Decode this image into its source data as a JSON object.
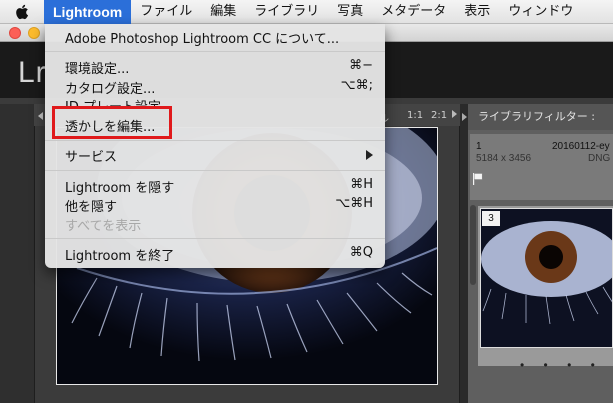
{
  "menubar": {
    "apple": "apple-icon",
    "items": [
      "Lightroom",
      "ファイル",
      "編集",
      "ライブラリ",
      "写真",
      "メタデータ",
      "表示",
      "ウィンドウ"
    ],
    "active_index": 0
  },
  "app": {
    "logo_text": "Lr"
  },
  "toolbar": {
    "zoom_fit": "ル",
    "zoom_1": "1:1",
    "zoom_2": "2:1"
  },
  "dropdown": {
    "items": [
      {
        "label": "Adobe Photoshop Lightroom CC について...",
        "shortcut": ""
      },
      {
        "label": "環境設定...",
        "shortcut": "⌘−"
      },
      {
        "label": "カタログ設定...",
        "shortcut": "⌥⌘;"
      },
      {
        "label": "ID プレート設定...",
        "shortcut": ""
      },
      {
        "label": "透かしを編集...",
        "shortcut": ""
      },
      {
        "label": "サービス",
        "shortcut": ""
      },
      {
        "label": "Lightroom を隠す",
        "shortcut": "⌘H"
      },
      {
        "label": "他を隠す",
        "shortcut": "⌥⌘H"
      },
      {
        "label": "すべてを表示",
        "shortcut": "",
        "disabled": true
      },
      {
        "label": "Lightroom を終了",
        "shortcut": "⌘Q"
      }
    ],
    "highlighted_item": "透かしを編集...",
    "highlight_color": "#e0191b"
  },
  "right_panel": {
    "filter_label": "ライブラリフィルター :",
    "cell_1": {
      "number": "1",
      "filename": "20160112-ey",
      "dimensions": "5184 x 3456",
      "filetype": "DNG"
    },
    "cell_3": {
      "number": "3"
    },
    "dots": "• • • •"
  },
  "colors": {
    "menu_active": "#2b6fd9",
    "highlight_box": "#e0191b"
  }
}
